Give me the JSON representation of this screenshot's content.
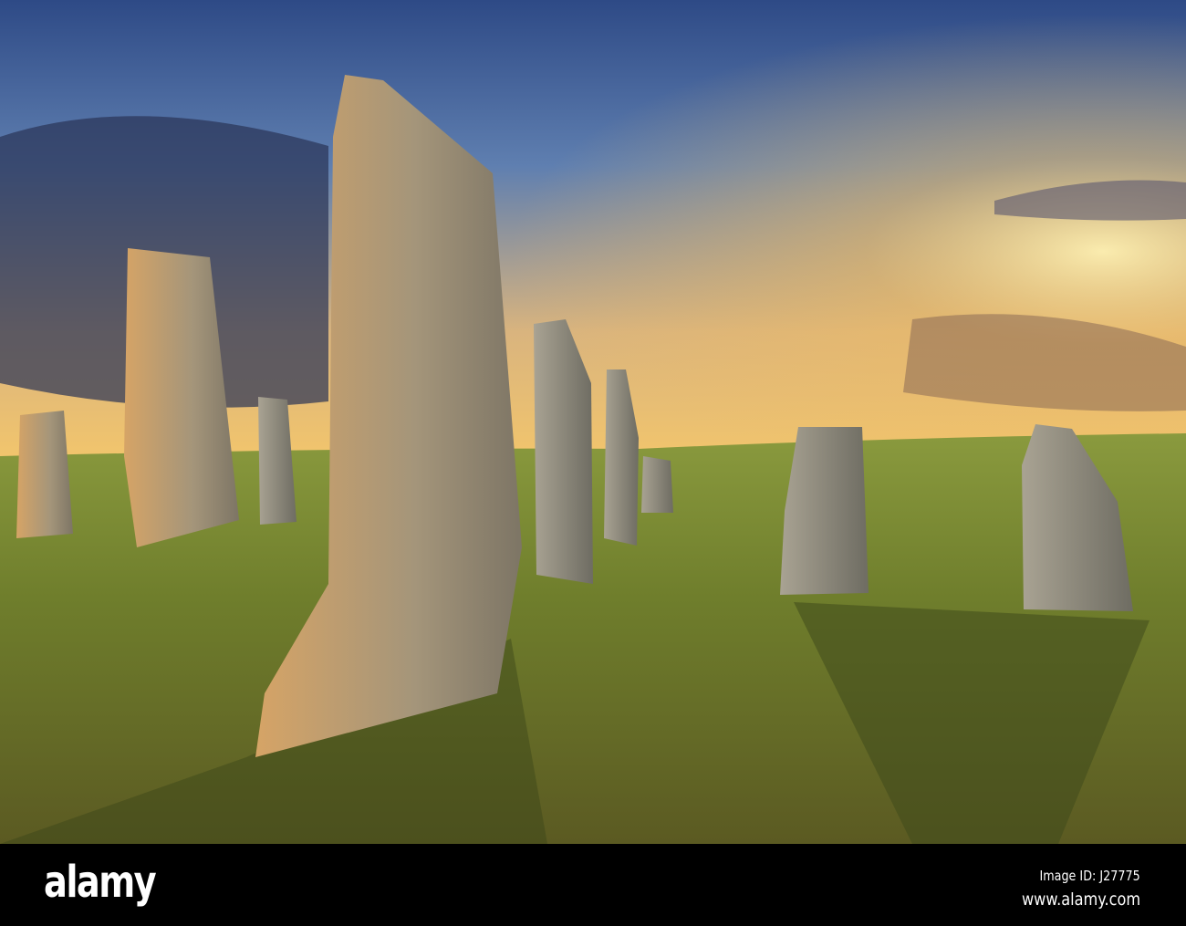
{
  "photo": {
    "subject": "standing-stones-at-sunset"
  },
  "footer": {
    "logo": "alamy",
    "image_id": "Image ID: J27775",
    "website": "www.alamy.com"
  }
}
